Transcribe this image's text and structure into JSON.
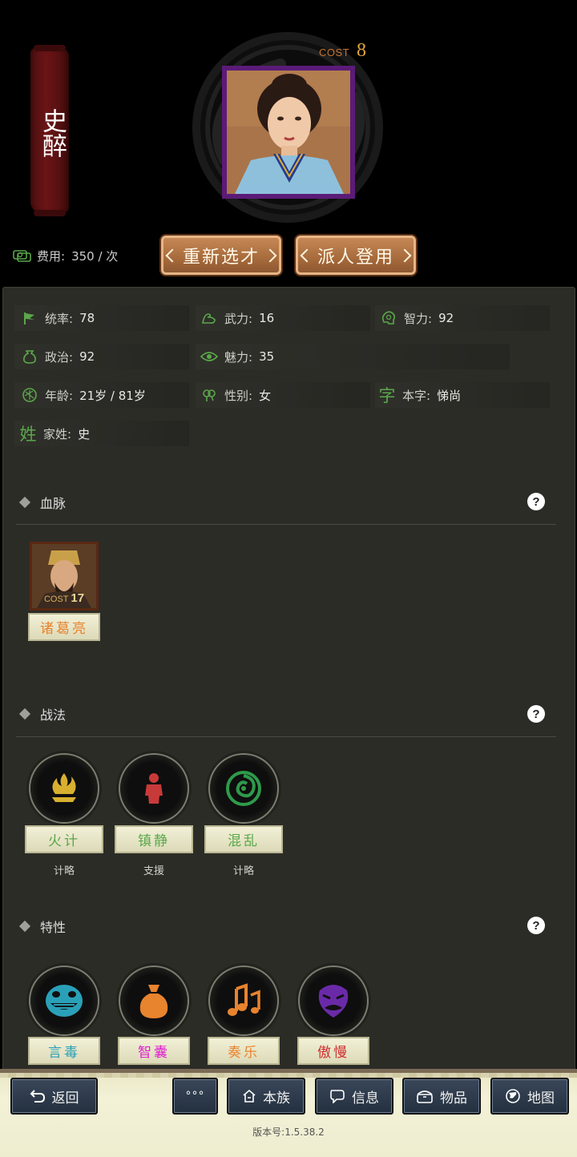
{
  "character": {
    "name": "史醉",
    "cost_label": "COST",
    "cost_value": "8"
  },
  "fee": {
    "label": "费用:",
    "value": "350 / 次"
  },
  "actions": {
    "reselect": "重新选才",
    "dispatch": "派人登用"
  },
  "stats": [
    {
      "label": "统率:",
      "value": "78"
    },
    {
      "label": "武力:",
      "value": "16"
    },
    {
      "label": "智力:",
      "value": "92"
    },
    {
      "label": "政治:",
      "value": "92"
    },
    {
      "label": "魅力:",
      "value": "35"
    },
    {
      "label": "年龄:",
      "value": "21岁 / 81岁"
    },
    {
      "label": "性别:",
      "value": "女"
    },
    {
      "label": "本字:",
      "value": "悌尚",
      "icon_char": "字"
    },
    {
      "label": "家姓:",
      "value": "史",
      "icon_char": "姓"
    }
  ],
  "sections": {
    "bloodline": "血脉",
    "tactics": "战法",
    "traits": "特性"
  },
  "help": "?",
  "bloodline": {
    "name": "诸葛亮",
    "cost_label": "COST",
    "cost_value": "17",
    "name_color": "#e8832e"
  },
  "tactics": [
    {
      "name": "火计",
      "type": "计略",
      "color": "#5aa84a",
      "icon": "fire-icon"
    },
    {
      "name": "镇静",
      "type": "支援",
      "color": "#5aa84a",
      "icon": "figure-icon"
    },
    {
      "name": "混乱",
      "type": "计略",
      "color": "#5aa84a",
      "icon": "swirl-icon"
    }
  ],
  "traits": [
    {
      "name": "言毒",
      "color": "#2aa0b8",
      "icon": "grin-mask-icon"
    },
    {
      "name": "智囊",
      "color": "#e020d0",
      "icon": "sack-icon"
    },
    {
      "name": "奏乐",
      "color": "#e8832e",
      "icon": "music-note-icon"
    },
    {
      "name": "傲慢",
      "color": "#d03030",
      "icon": "scowl-mask-icon"
    }
  ],
  "nav": {
    "back": "返回",
    "more": "°°°",
    "clan": "本族",
    "info": "信息",
    "items": "物品",
    "map": "地图"
  },
  "version": "版本号:1.5.38.2"
}
